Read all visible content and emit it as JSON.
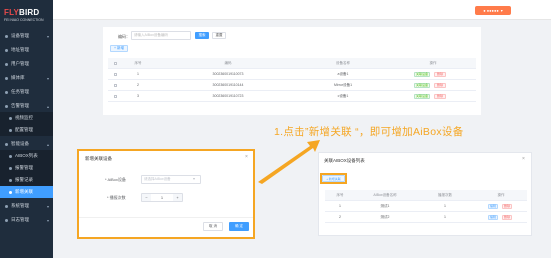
{
  "brand": {
    "logo_prefix": "FLY",
    "logo_suffix": "BIRD",
    "logo_sub": "FEI NIAO  CONNECTION"
  },
  "sidebar": {
    "items": [
      {
        "label": "设备管理"
      },
      {
        "label": "地址管理"
      },
      {
        "label": "用户管理"
      },
      {
        "label": "媒体库"
      },
      {
        "label": "任务管理"
      },
      {
        "label": "告警管理"
      },
      {
        "label": "视频监控"
      },
      {
        "label": "配置管理"
      },
      {
        "label": "智能设备"
      },
      {
        "label": "AIBOX列表"
      },
      {
        "label": "报警管理"
      },
      {
        "label": "报警记录"
      },
      {
        "label": "新增关联"
      },
      {
        "label": "系统管理"
      },
      {
        "label": "日志管理"
      }
    ]
  },
  "header": {
    "user_label": "● ●●●●●"
  },
  "filter": {
    "label": "编码：",
    "placeholder": "请输入AIBox设备编码",
    "query_label": "搜索",
    "reset_label": "重置"
  },
  "toolbar": {
    "add_label": "+ 新增"
  },
  "device_table": {
    "headers": [
      "序号",
      "编码",
      "设备名称",
      "操作"
    ],
    "rows": [
      {
        "index": "1",
        "code": "3002360019110073",
        "name": "a设备1"
      },
      {
        "index": "2",
        "code": "3002360019110144",
        "name": "Mirror设备1"
      },
      {
        "index": "3",
        "code": "3002360019110723",
        "name": "c设备1"
      }
    ],
    "op_view": "关联设备",
    "op_delete": "删除"
  },
  "annotation": {
    "text": "1.点击”新增关联 “，即可增加AiBox设备"
  },
  "add_dialog": {
    "title": "新增关联设备",
    "device_label": "* AiBox设备",
    "device_placeholder": "请选择AiBox设备",
    "order_label": "* 播报次数",
    "order_value": "1",
    "minus": "−",
    "plus": "+",
    "cancel_label": "取 消",
    "confirm_label": "确 定",
    "close": "×"
  },
  "relation_dialog": {
    "title": "关联AIBOX设备列表",
    "add_label": "+ 新增关联",
    "close": "×",
    "headers": [
      "序号",
      "AIBox设备名称",
      "播报次数",
      "操作"
    ],
    "rows": [
      {
        "index": "1",
        "name": "测试1",
        "count": "1"
      },
      {
        "index": "2",
        "name": "测试2",
        "count": "1"
      }
    ],
    "op_edit": "编辑",
    "op_delete": "删除"
  },
  "colors": {
    "accent": "#409eff",
    "annotation": "#f5a623",
    "sidebar": "#1f2d3d",
    "user_button": "#ff7b4a"
  }
}
